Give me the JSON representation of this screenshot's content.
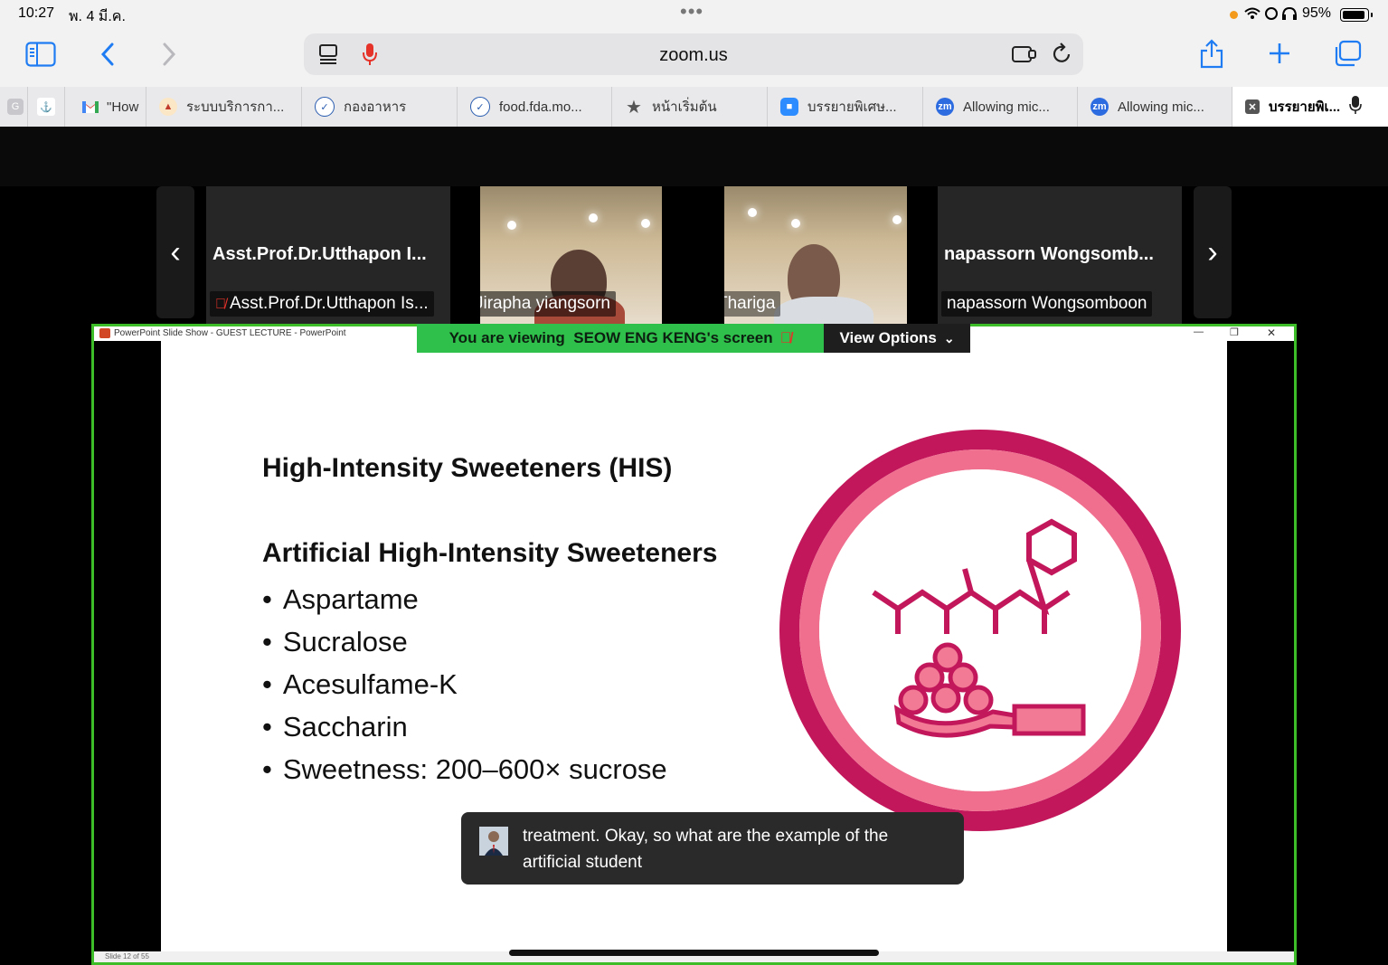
{
  "status": {
    "time": "10:27",
    "date": "พ. 4 มี.ค.",
    "battery": "95%"
  },
  "toolbar": {
    "url": "zoom.us"
  },
  "tabs": [
    {
      "label": "G"
    },
    {
      "label": ""
    },
    {
      "label": "\"How"
    },
    {
      "label": "ระบบบริการกา..."
    },
    {
      "label": "กองอาหาร"
    },
    {
      "label": "food.fda.mo..."
    },
    {
      "label": "หน้าเริ่มต้น"
    },
    {
      "label": "บรรยายพิเศษ..."
    },
    {
      "label": "Allowing mic..."
    },
    {
      "label": "Allowing mic..."
    },
    {
      "label": "บรรยายพิเ..."
    }
  ],
  "gallery": {
    "tiles": [
      {
        "bigname": "Asst.Prof.Dr.Utthapon I...",
        "label": "Asst.Prof.Dr.Utthapon Is..."
      },
      {
        "label": "Jirapha yiangsorn"
      },
      {
        "label": "Thariga"
      },
      {
        "bigname": "napassorn Wongsomb...",
        "label": "napassorn Wongsomboon"
      }
    ]
  },
  "share": {
    "banner_prefix": "You are viewing",
    "banner_name": "SEOW ENG KENG's screen",
    "view_options": "View Options",
    "ppt_title": "PowerPoint Slide Show  -  GUEST LECTURE - PowerPoint",
    "slide_footer": "Slide 12 of 55"
  },
  "slide": {
    "title": "High-Intensity Sweeteners (HIS)",
    "subtitle": "Artificial High-Intensity Sweeteners",
    "bullets": [
      "Aspartame",
      "Sucralose",
      "Acesulfame-K",
      "Saccharin",
      "Sweetness: 200–600× sucrose"
    ]
  },
  "caption": {
    "text": "treatment. Okay, so what are the example of the artificial student"
  },
  "colors": {
    "share_border": "#3dbd28",
    "banner": "#2ec04a",
    "ring_outer": "#c2185b",
    "ring_inner": "#f06f8f",
    "accent_blue": "#1f7cf2"
  }
}
